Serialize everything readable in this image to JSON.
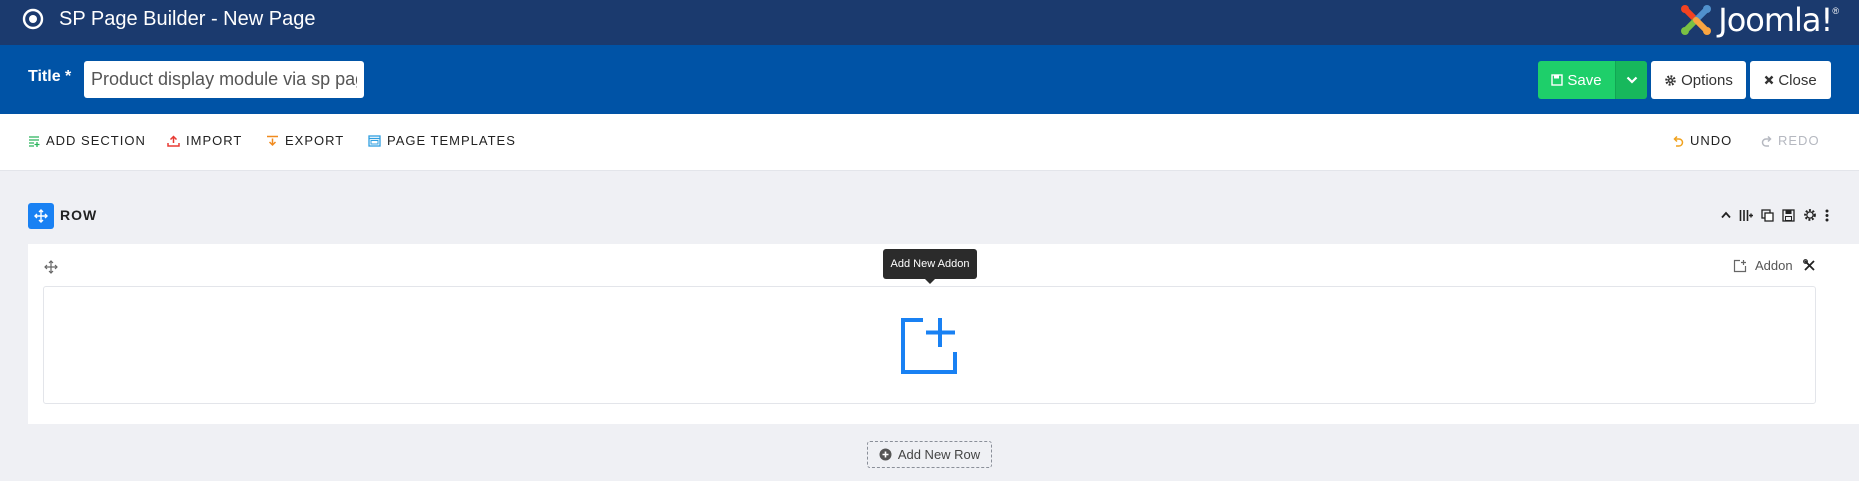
{
  "window": {
    "title": "SP Page Builder - New Page",
    "logo_text": "Joomla!",
    "logo_mark": "®"
  },
  "titlebar": {
    "label": "Title *",
    "input_value": "Product display module via sp page builder",
    "save_label": "Save",
    "options_label": "Options",
    "close_label": "Close"
  },
  "toolbar": {
    "add_section": "ADD SECTION",
    "import": "IMPORT",
    "export": "EXPORT",
    "page_templates": "PAGE TEMPLATES",
    "undo": "UNDO",
    "redo": "REDO"
  },
  "row": {
    "label": "ROW",
    "addon_label": "Addon",
    "tooltip": "Add New Addon",
    "add_new_row": "Add New Row"
  },
  "colors": {
    "topbar": "#1b3a6e",
    "titlebar": "#0053a6",
    "save": "#1ecf6a",
    "accent": "#1981f3",
    "add_section_icon": "#2ab55c",
    "import_icon": "#e83a33",
    "export_icon": "#f08a1e",
    "templates_icon": "#2f9fe0",
    "undo_icon": "#f0a21e"
  }
}
